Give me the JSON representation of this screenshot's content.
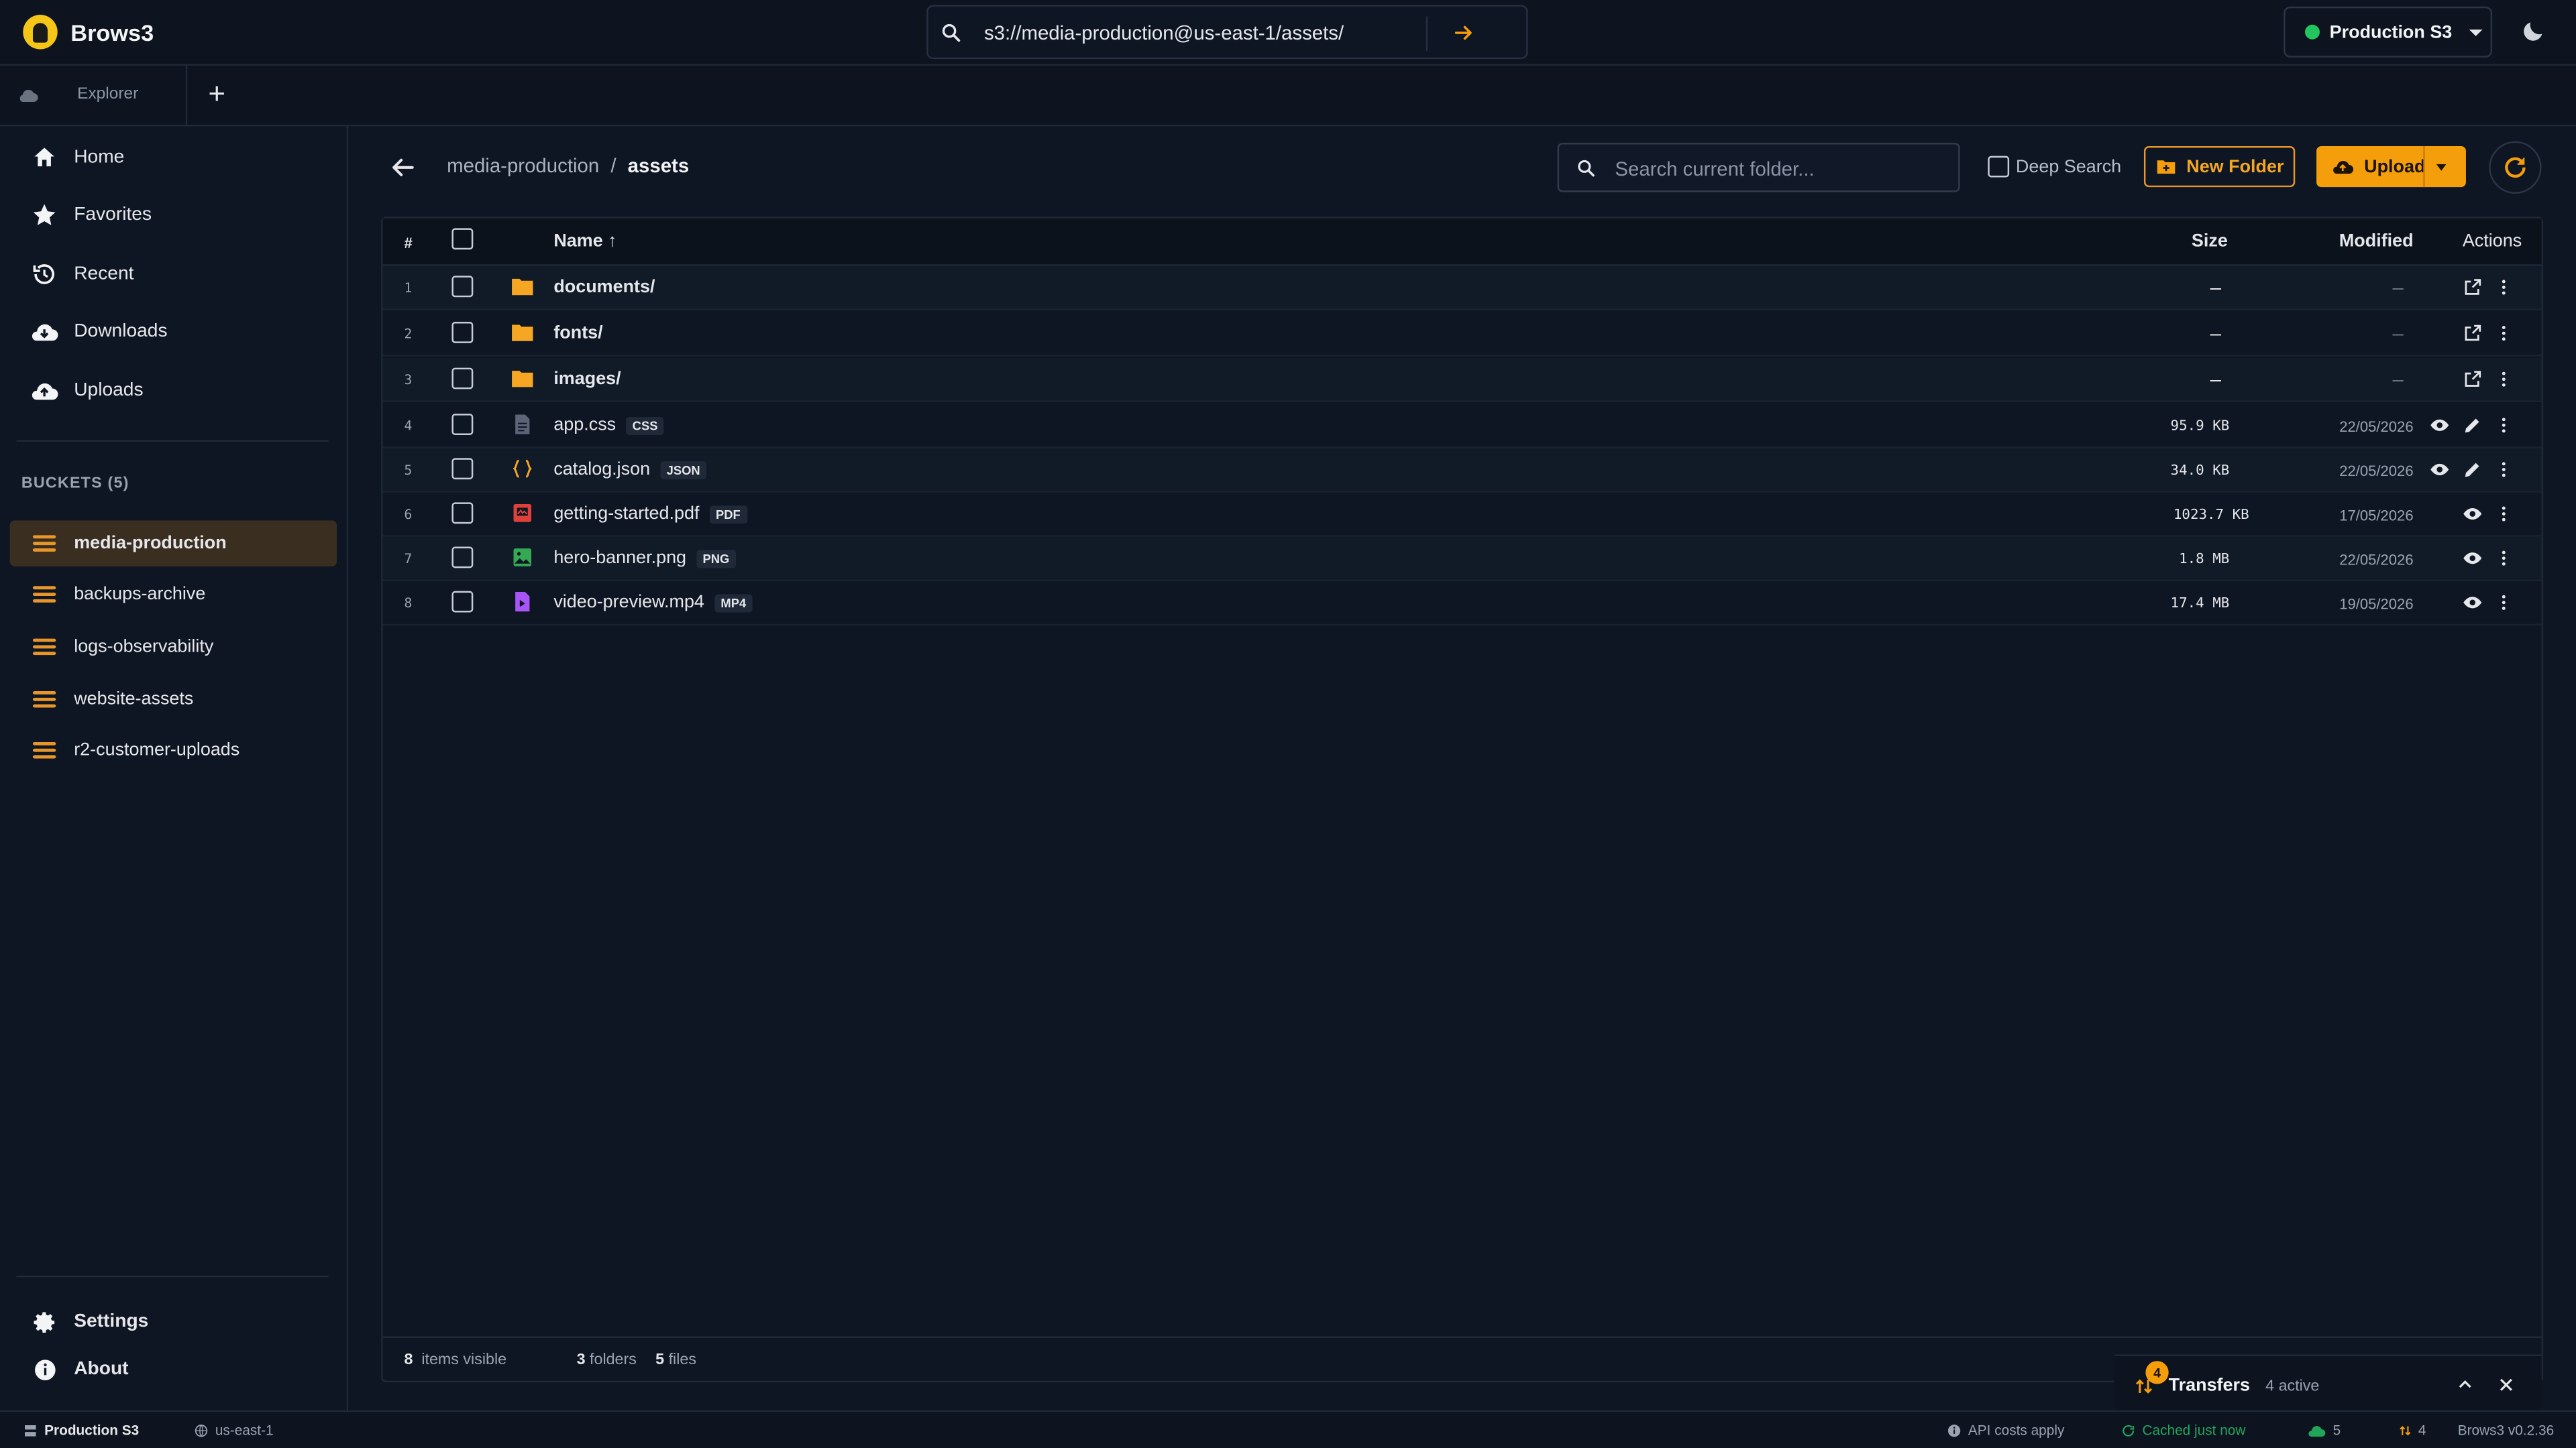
{
  "app": {
    "name": "Brows3",
    "version": "Brows3 v0.2.36"
  },
  "topbar": {
    "url": "s3://media-production@us-east-1/assets/",
    "environment": "Production S3",
    "environment_status_color": "#22c55e"
  },
  "tabs": [
    {
      "label": "Explorer"
    }
  ],
  "sidebar": {
    "nav": [
      {
        "label": "Home",
        "icon": "home-icon"
      },
      {
        "label": "Favorites",
        "icon": "star-icon"
      },
      {
        "label": "Recent",
        "icon": "history-icon"
      },
      {
        "label": "Downloads",
        "icon": "cloud-download-icon"
      },
      {
        "label": "Uploads",
        "icon": "cloud-upload-icon"
      }
    ],
    "buckets_heading": "BUCKETS (5)",
    "buckets": [
      {
        "label": "media-production",
        "active": true
      },
      {
        "label": "backups-archive",
        "active": false
      },
      {
        "label": "logs-observability",
        "active": false
      },
      {
        "label": "website-assets",
        "active": false
      },
      {
        "label": "r2-customer-uploads",
        "active": false
      }
    ],
    "bottom": [
      {
        "label": "Settings",
        "icon": "gear-icon"
      },
      {
        "label": "About",
        "icon": "info-icon"
      }
    ]
  },
  "toolbar": {
    "breadcrumb": {
      "root": "media-production",
      "separator": "/",
      "current": "assets"
    },
    "search_placeholder": "Search current folder...",
    "deep_search_label": "Deep Search",
    "new_folder_label": "New Folder",
    "upload_label": "Upload",
    "accent_color": "#f59e0b"
  },
  "table": {
    "headers": {
      "num": "#",
      "name": "Name ↑",
      "size": "Size",
      "modified": "Modified",
      "actions": "Actions"
    },
    "rows": [
      {
        "num": "1",
        "name": "documents/",
        "type": "folder",
        "tag": "",
        "size": "–",
        "modified": "–"
      },
      {
        "num": "2",
        "name": "fonts/",
        "type": "folder",
        "tag": "",
        "size": "–",
        "modified": "–"
      },
      {
        "num": "3",
        "name": "images/",
        "type": "folder",
        "tag": "",
        "size": "–",
        "modified": "–"
      },
      {
        "num": "4",
        "name": "app.css",
        "type": "css",
        "tag": "CSS",
        "size": "95.9 KB",
        "modified": "22/05/2026"
      },
      {
        "num": "5",
        "name": "catalog.json",
        "type": "json",
        "tag": "JSON",
        "size": "34.0 KB",
        "modified": "22/05/2026"
      },
      {
        "num": "6",
        "name": "getting-started.pdf",
        "type": "pdf",
        "tag": "PDF",
        "size": "1023.7 KB",
        "modified": "17/05/2026"
      },
      {
        "num": "7",
        "name": "hero-banner.png",
        "type": "png",
        "tag": "PNG",
        "size": "1.8 MB",
        "modified": "22/05/2026"
      },
      {
        "num": "8",
        "name": "video-preview.mp4",
        "type": "mp4",
        "tag": "MP4",
        "size": "17.4 MB",
        "modified": "19/05/2026"
      }
    ],
    "footer": {
      "items_count": "8",
      "items_label": "items visible",
      "folders_count": "3",
      "folders_label": "folders",
      "files_count": "5",
      "files_label": "files"
    }
  },
  "transfers": {
    "label": "Transfers",
    "active": "4 active",
    "badge": "4"
  },
  "statusbar": {
    "profile": "Production S3",
    "region": "us-east-1",
    "api_costs": "API costs apply",
    "cache": "Cached just now",
    "cloud_count": "5",
    "transfer_count": "4"
  }
}
